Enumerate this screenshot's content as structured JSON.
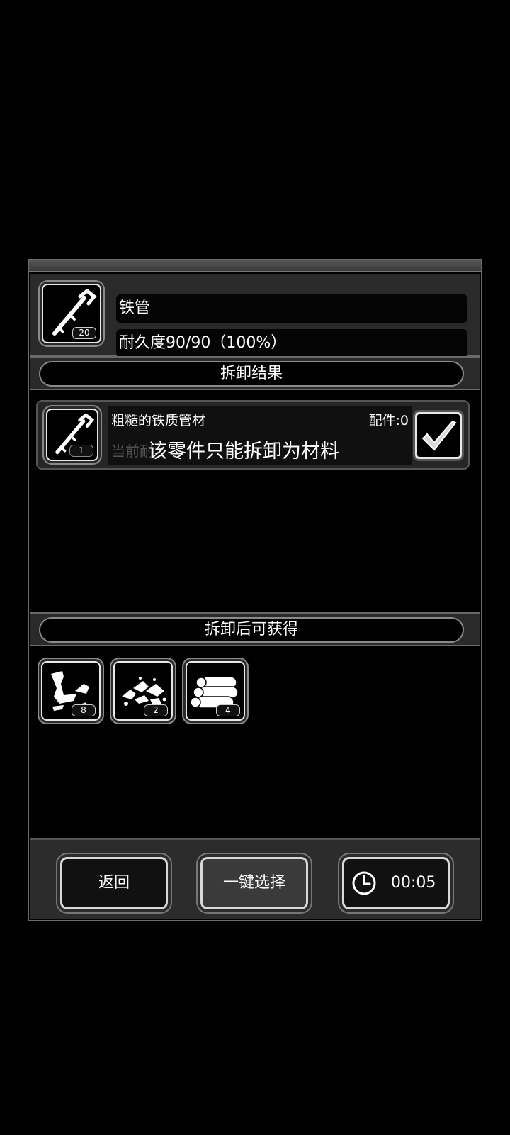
{
  "item": {
    "name": "铁管",
    "durability": "耐久度90/90（100%）",
    "icon": "iron-pipe-icon",
    "count": "20"
  },
  "sections": {
    "result_title": "拆卸结果",
    "gain_title": "拆卸后可获得"
  },
  "result": {
    "name": "粗糙的铁质管材",
    "parts": "配件:0",
    "dim_text": "当前耐",
    "note": "该零件只能拆卸为材料",
    "count": "1",
    "checked": true
  },
  "materials": [
    {
      "icon": "scrap-metal-icon",
      "count": "8"
    },
    {
      "icon": "rubble-icon",
      "count": "2"
    },
    {
      "icon": "logs-icon",
      "count": "4"
    }
  ],
  "buttons": {
    "back": "返回",
    "select_all": "一键选择",
    "timer": "00:05"
  }
}
